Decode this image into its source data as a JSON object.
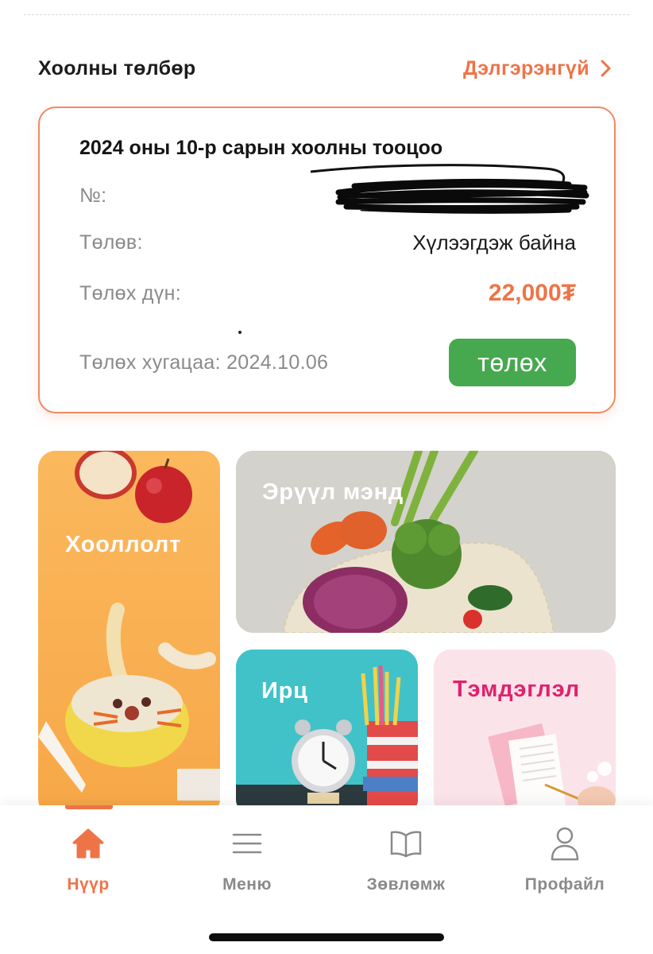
{
  "section": {
    "title": "Хоолны төлбөр",
    "more_label": "Дэлгэрэнгүй"
  },
  "bill": {
    "title": "2024 оны 10-р сарын хоолны тооцоо",
    "number_label": "№:",
    "status_label": "Төлөв:",
    "status_value": "Хүлээгдэж байна",
    "amount_label": "Төлөх дүн:",
    "amount_value": "22,000₮",
    "due_label": "Төлөх хугацаа: 2024.10.06",
    "pay_button": "төлөх"
  },
  "tiles": {
    "food": "Хооллолт",
    "health": "Эрүүл мэнд",
    "attendance": "Ирц",
    "notes": "Тэмдэглэл"
  },
  "tabs": [
    {
      "label": "Нүүр",
      "icon": "home-icon",
      "active": true
    },
    {
      "label": "Меню",
      "icon": "menu-icon",
      "active": false
    },
    {
      "label": "Зөвлөмж",
      "icon": "book-icon",
      "active": false
    },
    {
      "label": "Профайл",
      "icon": "profile-icon",
      "active": false
    }
  ],
  "colors": {
    "accent": "#ee7448",
    "pay_button": "#46a94f",
    "notes_label": "#e0226b"
  }
}
